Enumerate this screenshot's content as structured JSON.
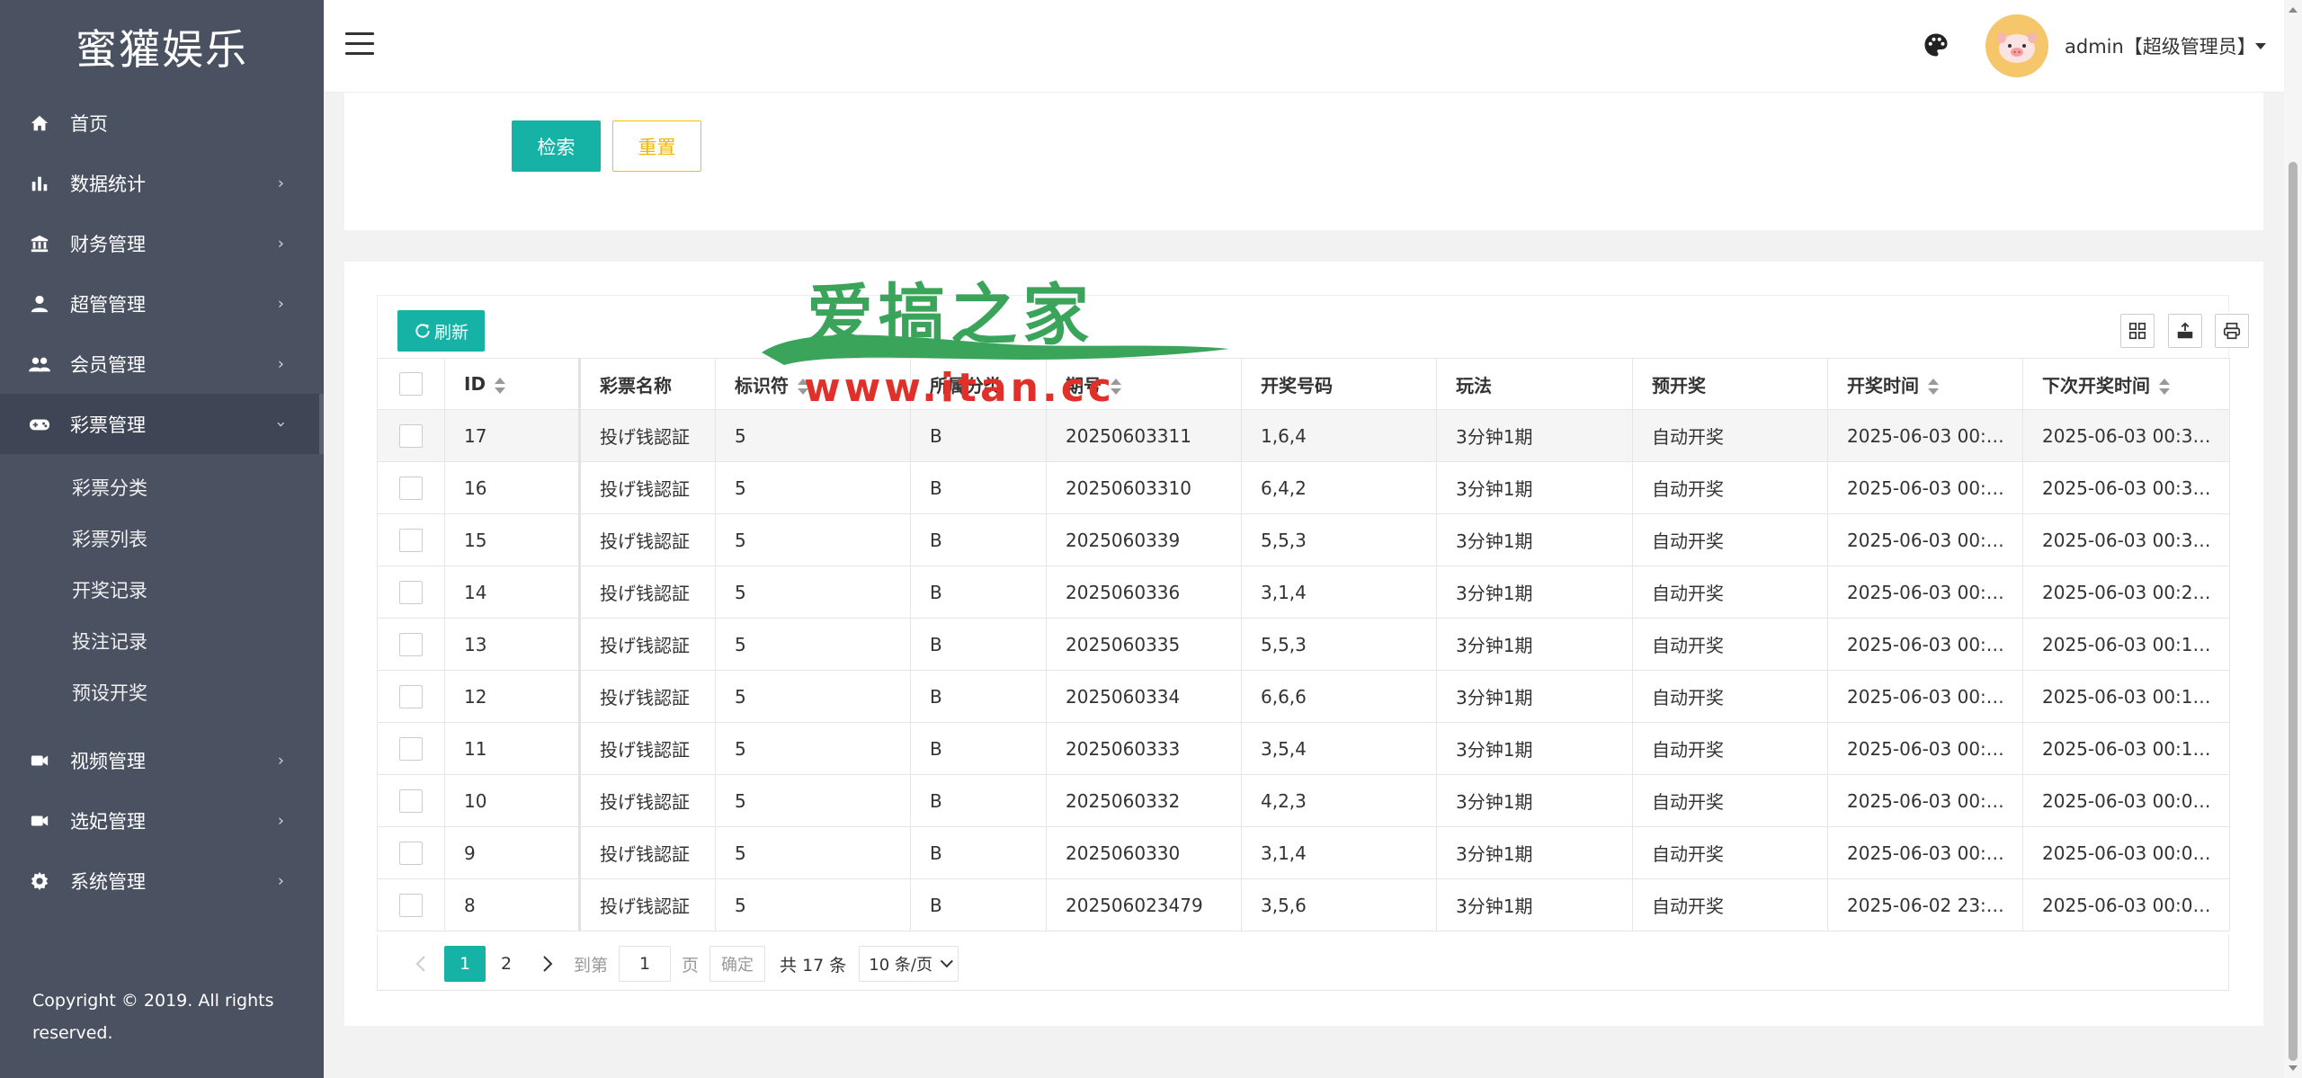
{
  "brand": "蜜獾娱乐",
  "sidebar": {
    "items": [
      {
        "label": "首页",
        "icon": "home-icon"
      },
      {
        "label": "数据统计",
        "icon": "bar-chart-icon"
      },
      {
        "label": "财务管理",
        "icon": "bank-icon"
      },
      {
        "label": "超管管理",
        "icon": "user-icon"
      },
      {
        "label": "会员管理",
        "icon": "users-icon"
      },
      {
        "label": "彩票管理",
        "icon": "gamepad-icon"
      },
      {
        "label": "视频管理",
        "icon": "video-camera-icon"
      },
      {
        "label": "选妃管理",
        "icon": "video-camera-icon"
      },
      {
        "label": "系统管理",
        "icon": "gear-icon"
      }
    ],
    "sub_items": [
      "彩票分类",
      "彩票列表",
      "开奖记录",
      "投注记录",
      "预设开奖"
    ],
    "copyright": "Copyright © 2019. All rights reserved."
  },
  "header": {
    "user": "admin【超级管理员】"
  },
  "search": {
    "search_label": "检索",
    "reset_label": "重置"
  },
  "toolbar": {
    "refresh_label": "刷新"
  },
  "table": {
    "columns": [
      "ID",
      "彩票名称",
      "标识符",
      "所属分类",
      "期号",
      "开奖号码",
      "玩法",
      "预开奖",
      "开奖时间",
      "下次开奖时间"
    ],
    "rows": [
      [
        "17",
        "投げ钱認証",
        "5",
        "B",
        "20250603311",
        "1,6,4",
        "3分钟1期",
        "自动开奖",
        "2025-06-03 00:…",
        "2025-06-03 00:3…"
      ],
      [
        "16",
        "投げ钱認証",
        "5",
        "B",
        "20250603310",
        "6,4,2",
        "3分钟1期",
        "自动开奖",
        "2025-06-03 00:…",
        "2025-06-03 00:3…"
      ],
      [
        "15",
        "投げ钱認証",
        "5",
        "B",
        "2025060339",
        "5,5,3",
        "3分钟1期",
        "自动开奖",
        "2025-06-03 00:…",
        "2025-06-03 00:3…"
      ],
      [
        "14",
        "投げ钱認証",
        "5",
        "B",
        "2025060336",
        "3,1,4",
        "3分钟1期",
        "自动开奖",
        "2025-06-03 00:…",
        "2025-06-03 00:2…"
      ],
      [
        "13",
        "投げ钱認証",
        "5",
        "B",
        "2025060335",
        "5,5,3",
        "3分钟1期",
        "自动开奖",
        "2025-06-03 00:…",
        "2025-06-03 00:1…"
      ],
      [
        "12",
        "投げ钱認証",
        "5",
        "B",
        "2025060334",
        "6,6,6",
        "3分钟1期",
        "自动开奖",
        "2025-06-03 00:…",
        "2025-06-03 00:1…"
      ],
      [
        "11",
        "投げ钱認証",
        "5",
        "B",
        "2025060333",
        "3,5,4",
        "3分钟1期",
        "自动开奖",
        "2025-06-03 00:…",
        "2025-06-03 00:1…"
      ],
      [
        "10",
        "投げ钱認証",
        "5",
        "B",
        "2025060332",
        "4,2,3",
        "3分钟1期",
        "自动开奖",
        "2025-06-03 00:…",
        "2025-06-03 00:0…"
      ],
      [
        "9",
        "投げ钱認証",
        "5",
        "B",
        "2025060330",
        "3,1,4",
        "3分钟1期",
        "自动开奖",
        "2025-06-03 00:…",
        "2025-06-03 00:0…"
      ],
      [
        "8",
        "投げ钱認証",
        "5",
        "B",
        "202506023479",
        "3,5,6",
        "3分钟1期",
        "自动开奖",
        "2025-06-02 23:…",
        "2025-06-03 00:0…"
      ]
    ]
  },
  "pager": {
    "current": "1",
    "page2": "2",
    "goto_label": "到第",
    "page_value": "1",
    "page_unit": "页",
    "confirm_label": "确定",
    "total": "共 17 条",
    "page_size": "10 条/页"
  },
  "watermark": {
    "title": "爱搞之家",
    "url": "www.itan.cc"
  },
  "colors": {
    "sidebar_bg": "#4a5262",
    "accent": "#16b2a6",
    "reset": "#f2b500",
    "watermark_green": "#3aa55a",
    "watermark_red": "#e0302a"
  }
}
